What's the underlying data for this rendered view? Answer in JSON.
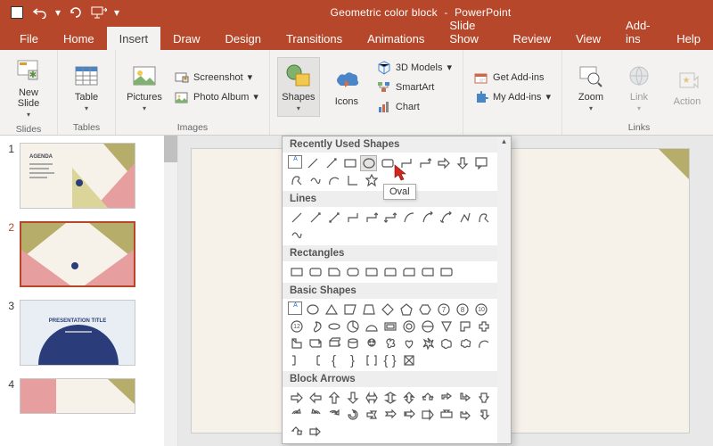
{
  "app": {
    "document_title": "Geometric color block",
    "app_name": "PowerPoint"
  },
  "qat": {
    "save": "Save",
    "undo": "Undo",
    "redo": "Redo",
    "start_from_beginning": "Start From Beginning"
  },
  "tabs": [
    "File",
    "Home",
    "Insert",
    "Draw",
    "Design",
    "Transitions",
    "Animations",
    "Slide Show",
    "Review",
    "View",
    "Add-ins",
    "Help"
  ],
  "active_tab": "Insert",
  "ribbon": {
    "slides": {
      "label": "Slides",
      "new_slide": "New\nSlide"
    },
    "tables": {
      "label": "Tables",
      "table": "Table"
    },
    "images": {
      "label": "Images",
      "pictures": "Pictures",
      "screenshot": "Screenshot",
      "photo_album": "Photo Album"
    },
    "illustrations": {
      "shapes": "Shapes",
      "icons": "Icons",
      "models3d": "3D Models",
      "smartart": "SmartArt",
      "chart": "Chart"
    },
    "addins": {
      "get": "Get Add-ins",
      "my": "My Add-ins"
    },
    "links": {
      "label": "Links",
      "zoom": "Zoom",
      "link": "Link",
      "action": "Action"
    }
  },
  "thumbnails": {
    "slides": [
      {
        "num": "1",
        "kind": "agenda",
        "title": "AGENDA"
      },
      {
        "num": "2",
        "kind": "geometric",
        "selected": true
      },
      {
        "num": "3",
        "kind": "title",
        "title": "PRESENTATION TITLE"
      },
      {
        "num": "4",
        "kind": "geometric-alt"
      }
    ]
  },
  "shapes_panel": {
    "sections": {
      "recent": "Recently Used Shapes",
      "lines": "Lines",
      "rects": "Rectangles",
      "basic": "Basic Shapes",
      "arrows": "Block Arrows"
    },
    "tooltip": "Oval"
  }
}
